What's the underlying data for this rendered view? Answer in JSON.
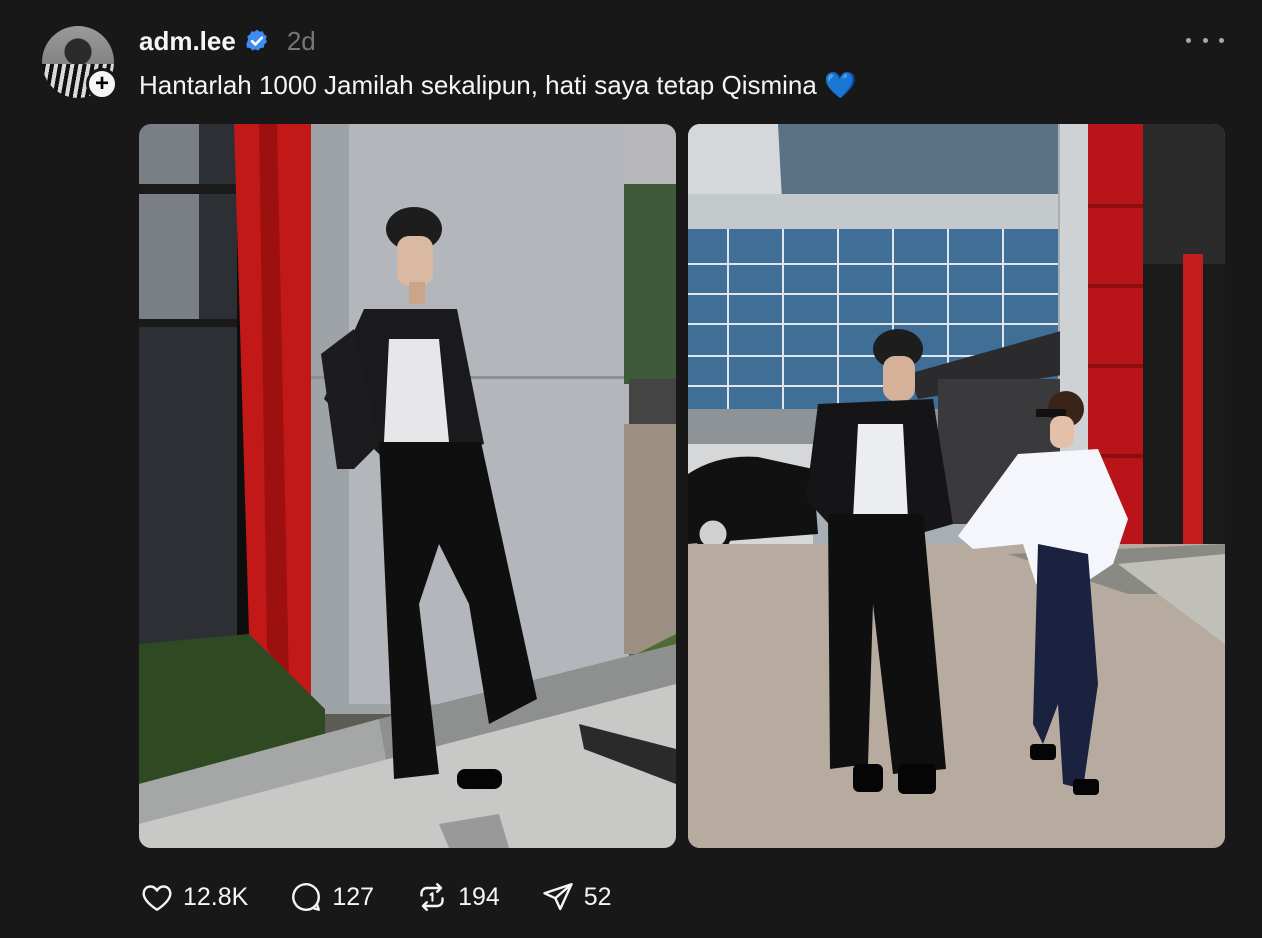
{
  "post": {
    "username": "adm.lee",
    "timestamp": "2d",
    "caption": "Hantarlah 1000 Jamilah sekalipun, hati saya tetap Qismina",
    "caption_emoji": "💙"
  },
  "icons": {
    "verified": "verified-badge-icon",
    "follow": "plus-icon",
    "more": "more-horizontal-icon",
    "like": "heart-icon",
    "comment": "comment-bubble-icon",
    "repost": "repost-icon",
    "share": "send-icon"
  },
  "stats": {
    "likes": "12.8K",
    "comments": "127",
    "reposts": "194",
    "shares": "52"
  },
  "colors": {
    "background": "#181818",
    "text": "#f3f5f7",
    "muted": "#777777",
    "verified_blue": "#3d8bf3"
  }
}
